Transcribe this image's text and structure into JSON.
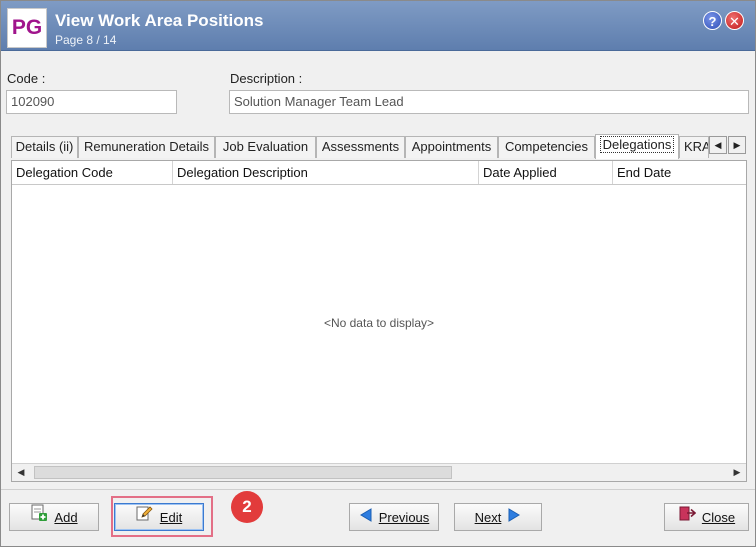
{
  "window": {
    "logo": "PG",
    "title": "View Work Area Positions",
    "subtitle": "Page 8 / 14",
    "help_glyph": "?",
    "close_glyph": "✕"
  },
  "fields": {
    "code_label": "Code :",
    "code_value": "102090",
    "description_label": "Description :",
    "description_value": "Solution Manager Team Lead"
  },
  "tabs": [
    {
      "label": "Details (ii)"
    },
    {
      "label": "Remuneration Details"
    },
    {
      "label": "Job Evaluation"
    },
    {
      "label": "Assessments"
    },
    {
      "label": "Appointments"
    },
    {
      "label": "Competencies"
    },
    {
      "label": "Delegations",
      "active": true
    },
    {
      "label": "KRA"
    }
  ],
  "grid": {
    "columns": [
      "Delegation Code",
      "Delegation Description",
      "Date Applied",
      "End Date"
    ],
    "empty_text": "<No data to display>"
  },
  "buttons": {
    "add": "Add",
    "edit": "Edit",
    "previous": "Previous",
    "next": "Next",
    "close": "Close"
  },
  "annotation": {
    "marker": "2"
  },
  "colors": {
    "titlebar": "#6d8cbb",
    "logo_text": "#a0148c",
    "highlight": "#e36f86",
    "marker": "#e23b3b"
  }
}
